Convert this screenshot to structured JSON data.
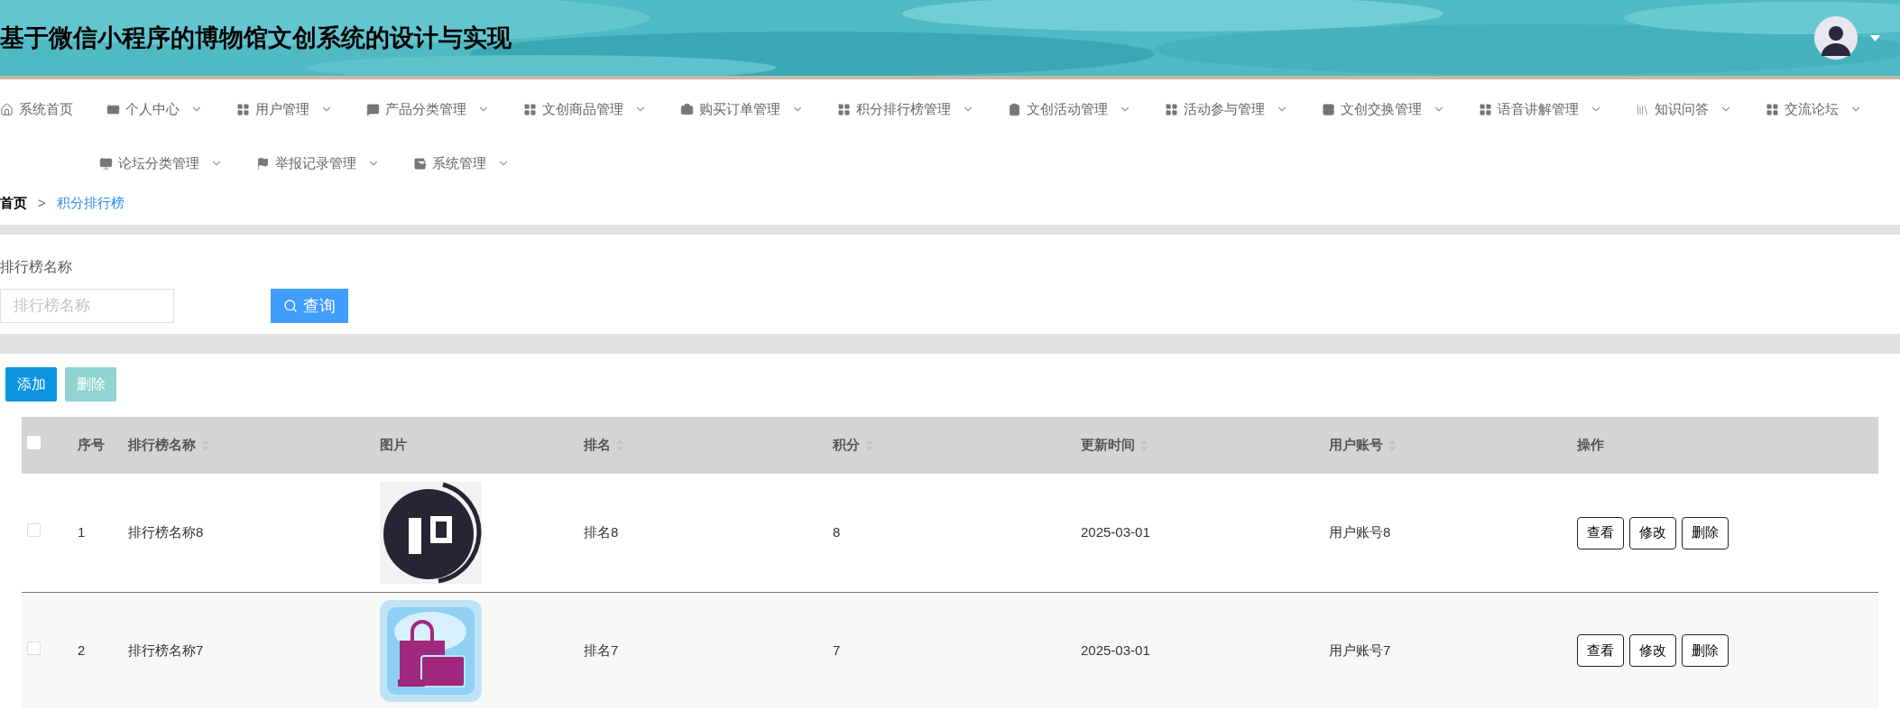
{
  "header": {
    "title": "基于微信小程序的博物馆文创系统的设计与实现"
  },
  "nav": [
    {
      "label": "系统首页",
      "dropdown": false
    },
    {
      "label": "个人中心",
      "dropdown": true
    },
    {
      "label": "用户管理",
      "dropdown": true
    },
    {
      "label": "产品分类管理",
      "dropdown": true
    },
    {
      "label": "文创商品管理",
      "dropdown": true
    },
    {
      "label": "购买订单管理",
      "dropdown": true
    },
    {
      "label": "积分排行榜管理",
      "dropdown": true
    },
    {
      "label": "文创活动管理",
      "dropdown": true
    },
    {
      "label": "活动参与管理",
      "dropdown": true
    },
    {
      "label": "文创交换管理",
      "dropdown": true
    },
    {
      "label": "语音讲解管理",
      "dropdown": true
    },
    {
      "label": "知识问答",
      "dropdown": true
    },
    {
      "label": "交流论坛",
      "dropdown": true
    },
    {
      "label": "论坛分类管理",
      "dropdown": true
    },
    {
      "label": "举报记录管理",
      "dropdown": true
    },
    {
      "label": "系统管理",
      "dropdown": true
    }
  ],
  "breadcrumb": [
    {
      "label": "首页",
      "selected": false
    },
    {
      "label": ">",
      "selected": false
    },
    {
      "label": "积分排行榜",
      "selected": true
    }
  ],
  "search": {
    "label": "排行榜名称",
    "placeholder": "排行榜名称",
    "button": "查询"
  },
  "toolbar": [
    {
      "label": "添加",
      "disabled": false
    },
    {
      "label": "删除",
      "disabled": true
    }
  ],
  "table": {
    "columns": [
      {
        "label": "序号",
        "sortable": false
      },
      {
        "label": "排行榜名称",
        "sortable": true
      },
      {
        "label": "图片",
        "sortable": false
      },
      {
        "label": "排名",
        "sortable": true
      },
      {
        "label": "积分",
        "sortable": true
      },
      {
        "label": "更新时间",
        "sortable": true
      },
      {
        "label": "用户账号",
        "sortable": true
      },
      {
        "label": "操作",
        "sortable": false
      }
    ],
    "all_checked": false,
    "rows": [
      {
        "checked": false,
        "index": "1",
        "name": "排行榜名称8",
        "rank": "排名8",
        "points": "8",
        "updated": "2025-03-01",
        "account": "用户账号8",
        "actions": [
          "查看",
          "修改",
          "删除"
        ]
      },
      {
        "checked": false,
        "index": "2",
        "name": "排行榜名称7",
        "rank": "排名7",
        "points": "7",
        "updated": "2025-03-01",
        "account": "用户账号7",
        "actions": [
          "查看",
          "修改",
          "删除"
        ]
      }
    ]
  }
}
